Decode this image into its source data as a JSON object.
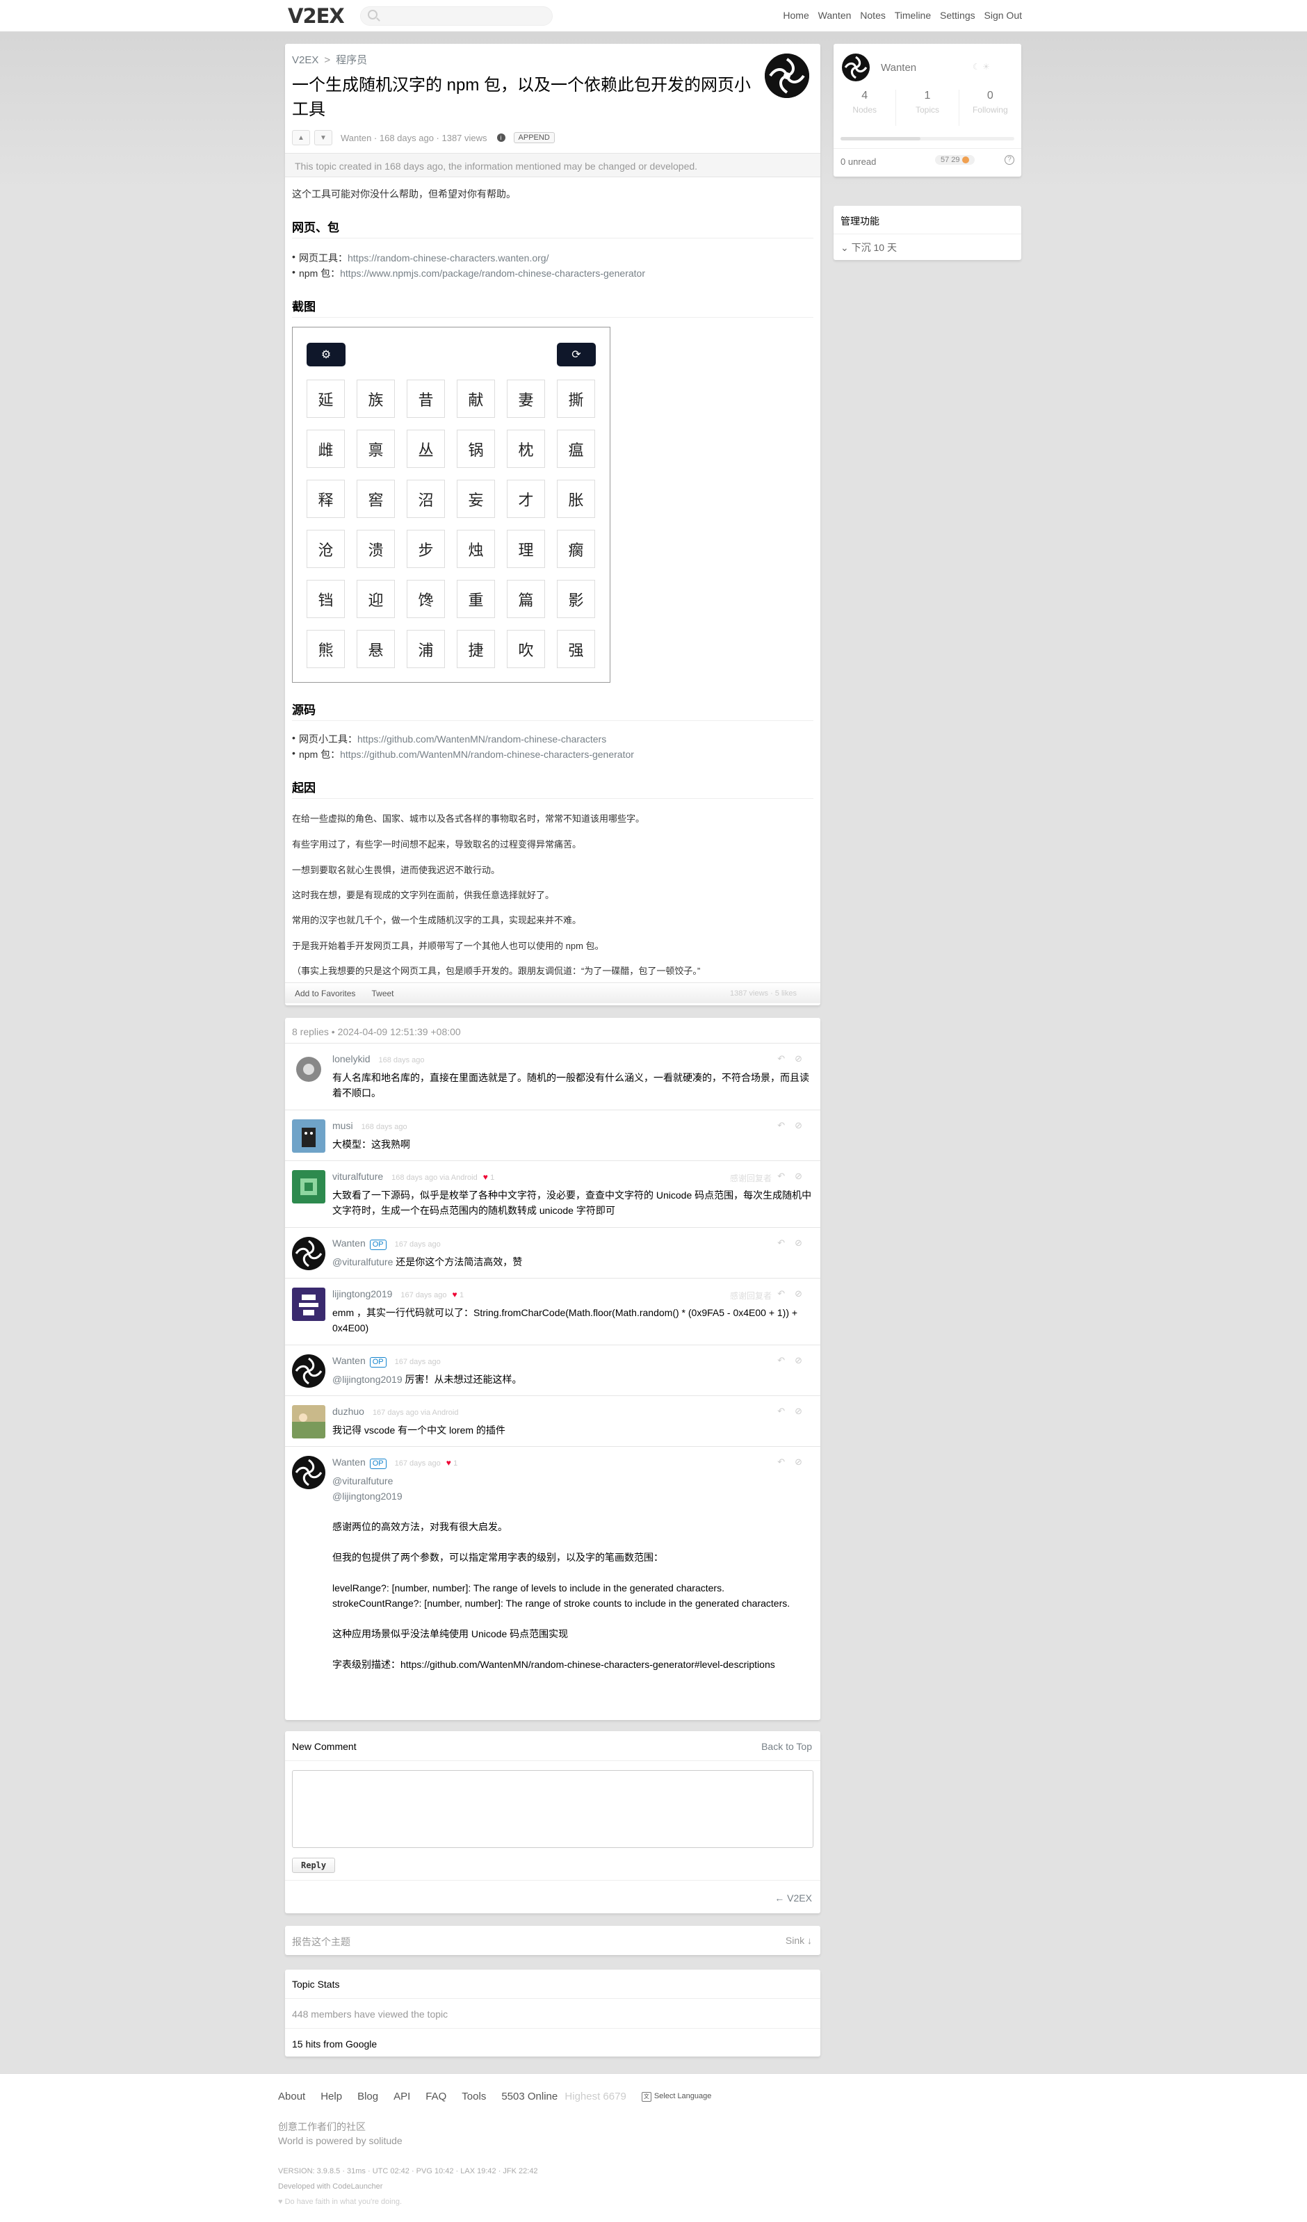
{
  "topbar": {
    "logo": "V2EX",
    "nav": [
      "Home",
      "Wanten",
      "Notes",
      "Timeline",
      "Settings",
      "Sign Out"
    ]
  },
  "topic": {
    "breadcrumb": [
      "V2EX",
      "程序员"
    ],
    "title": "一个生成随机汉字的 npm 包，以及一个依赖此包开发的网页小工具",
    "meta": "Wanten · 168 days ago · 1387 views",
    "append_label": "APPEND",
    "outdated": "This topic created in 168 days ago, the information mentioned may be changed or developed.",
    "intro": "这个工具可能对你没什么帮助，但希望对你有帮助。",
    "h_links": "网页、包",
    "links": [
      {
        "label": "网页工具：",
        "url": "https://random-chinese-characters.wanten.org/"
      },
      {
        "label": "npm 包：",
        "url": "https://www.npmjs.com/package/random-chinese-characters-generator"
      }
    ],
    "h_shot": "截图",
    "grid": [
      [
        "延",
        "族",
        "昔",
        "献",
        "妻",
        "撕"
      ],
      [
        "雌",
        "禀",
        "丛",
        "锅",
        "枕",
        "瘟"
      ],
      [
        "释",
        "窖",
        "沼",
        "妄",
        "才",
        "胀"
      ],
      [
        "沧",
        "溃",
        "步",
        "烛",
        "理",
        "瘸"
      ],
      [
        "铛",
        "迎",
        "馋",
        "重",
        "篇",
        "影"
      ],
      [
        "熊",
        "悬",
        "浦",
        "捷",
        "吹",
        "强"
      ]
    ],
    "h_src": "源码",
    "src_links": [
      {
        "label": "网页小工具：",
        "url": "https://github.com/WantenMN/random-chinese-characters"
      },
      {
        "label": "npm 包：",
        "url": "https://github.com/WantenMN/random-chinese-characters-generator"
      }
    ],
    "h_why": "起因",
    "why": [
      "在给一些虚拟的角色、国家、城市以及各式各样的事物取名时，常常不知道该用哪些字。",
      "有些字用过了，有些字一时间想不起来，导致取名的过程变得异常痛苦。",
      "一想到要取名就心生畏惧，进而使我迟迟不敢行动。",
      "这时我在想，要是有现成的文字列在面前，供我任意选择就好了。",
      "常用的汉字也就几千个，做一个生成随机汉字的工具，实现起来并不难。",
      "于是我开始着手开发网页工具，并顺带写了一个其他人也可以使用的 npm 包。",
      "（事实上我想要的只是这个网页工具，包是顺手开发的。跟朋友调侃道：“为了一碟醋，包了一顿饺子。”"
    ],
    "footer_links": [
      "Add to Favorites",
      "Tweet"
    ],
    "footer_stats": "1387 views · 5 likes"
  },
  "replies": {
    "header": "8 replies  •  2024-04-09 12:51:39 +08:00",
    "items": [
      {
        "name": "lonelykid",
        "op": "",
        "ago": "168 days ago",
        "hearts": "",
        "text": "有人名库和地名库的，直接在里面选就是了。随机的一般都没有什么涵义，一看就硬凑的，不符合场景，而且读着不顺口。"
      },
      {
        "name": "musi",
        "op": "",
        "ago": "168 days ago",
        "hearts": "",
        "text": "大模型：这我熟啊"
      },
      {
        "name": "vituralfuture",
        "op": "",
        "ago": "168 days ago via Android",
        "hearts": "1",
        "text": "大致看了一下源码，似乎是枚举了各种中文字符，没必要，查查中文字符的 Unicode 码点范围，每次生成随机中文字符时，生成一个在码点范围内的随机数转成 unicode 字符即可"
      },
      {
        "name": "Wanten",
        "op": "OP",
        "ago": "167 days ago",
        "hearts": "",
        "at": "@vituralfuture",
        "text": " 还是你这个方法简洁高效，赞"
      },
      {
        "name": "lijingtong2019",
        "op": "",
        "ago": "167 days ago",
        "hearts": "1",
        "text": "emm ，其实一行代码就可以了：String.fromCharCode(Math.floor(Math.random() * (0x9FA5 - 0x4E00 + 1)) + 0x4E00)"
      },
      {
        "name": "Wanten",
        "op": "OP",
        "ago": "167 days ago",
        "hearts": "",
        "at": "@lijingtong2019",
        "text": " 厉害！从未想过还能这样。"
      },
      {
        "name": "duzhuo",
        "op": "",
        "ago": "167 days ago via Android",
        "hearts": "",
        "text": "我记得 vscode 有一个中文 lorem 的插件"
      },
      {
        "name": "Wanten",
        "op": "OP",
        "ago": "167 days ago",
        "hearts": "1",
        "lines": [
          "@vituralfuture",
          "@lijingtong2019",
          "",
          "感谢两位的高效方法，对我有很大启发。",
          "",
          "但我的包提供了两个参数，可以指定常用字表的级别，以及字的笔画数范围：",
          "",
          "levelRange?: [number, number]: The range of levels to include in the generated characters.",
          "strokeCountRange?: [number, number]: The range of stroke counts to include in the generated characters.",
          "",
          "这种应用场景似乎没法单纯使用 Unicode 码点范围实现",
          "",
          "字表级别描述：https://github.com/WantenMN/random-chinese-characters-generator#level-descriptions"
        ]
      }
    ],
    "thank_label": "感谢回复者"
  },
  "sidebar": {
    "user": "Wanten",
    "stats": [
      {
        "num": "4",
        "label": "Nodes"
      },
      {
        "num": "1",
        "label": "Topics"
      },
      {
        "num": "0",
        "label": "Following"
      }
    ],
    "unread": "0 unread",
    "coins": "57  29",
    "admin_title": "管理功能",
    "admin_item": "下沉 10 天"
  },
  "newcomment": {
    "title": "New Comment",
    "back": "Back to Top",
    "reply": "Reply",
    "home": "← V2EX"
  },
  "report": {
    "left": "报告这个主题",
    "right": "Sink ↓"
  },
  "stats": {
    "title": "Topic Stats",
    "viewed": "448 members have viewed the topic",
    "google": "15 hits from Google"
  },
  "footer": {
    "links": [
      "About",
      "Help",
      "Blog",
      "API",
      "FAQ",
      "Tools"
    ],
    "online": "5503 Online",
    "highest": "Highest 6679",
    "lang": "Select Language",
    "line1": "创意工作者们的社区",
    "line2": "World is powered by solitude",
    "version": "VERSION: 3.9.8.5 · 31ms · UTC 02:42 · PVG 10:42 · LAX 19:42 · JFK 22:42",
    "dev": "Developed with CodeLauncher",
    "motto": "♥ Do have faith in what you're doing."
  }
}
